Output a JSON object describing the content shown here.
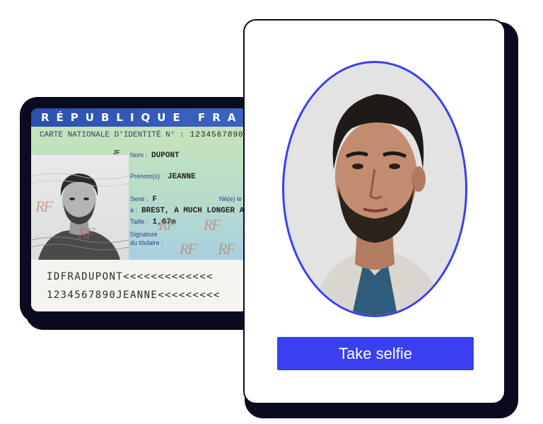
{
  "id_card": {
    "country": "RÉPUBLIQUE FRA",
    "card_type_label": "CARTE NATIONALE D'IDENTITÉ N° :",
    "card_number": "1234567890",
    "initials": "JF",
    "fields": {
      "nom_label": "Nom :",
      "nom_value": "DUPONT",
      "prenom_label": "Prénom(s) :",
      "prenom_value": "JEANNE",
      "sexe_label": "Sexe :",
      "sexe_value": "F",
      "ne_label": "Né(e) le",
      "a_label": "à :",
      "a_value": "BREST, A MUCH LONGER A",
      "taille_label": "Taille :",
      "taille_value": "1,67m",
      "signature_label": "Signature",
      "signature_label2": "du titulaire :"
    },
    "mrz": {
      "line1": "IDFRADUPONT<<<<<<<<<<<<<",
      "line2": "1234567890JEANNE<<<<<<<<<"
    },
    "watermark": "RF"
  },
  "selfie": {
    "button_label": "Take selfie",
    "accent_color": "#3a3ff0"
  }
}
